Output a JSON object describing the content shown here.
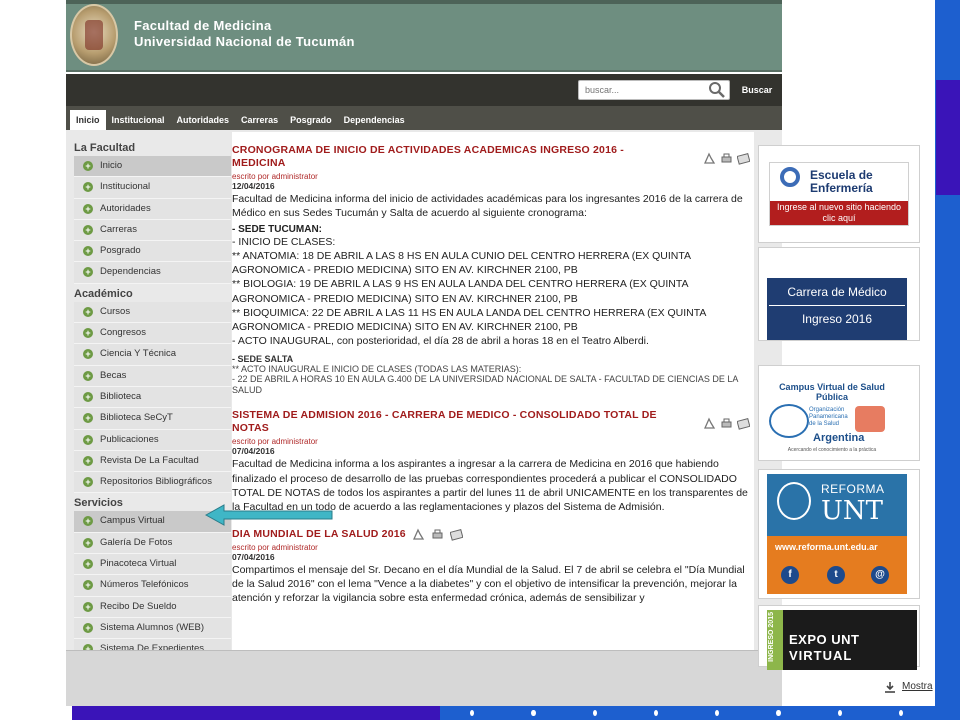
{
  "header": {
    "title_line1": "Facultad de Medicina",
    "title_line2": "Universidad Nacional de Tucumán"
  },
  "search": {
    "placeholder": "buscar...",
    "button_label": "Buscar"
  },
  "nav": {
    "tabs": [
      {
        "label": "Inicio"
      },
      {
        "label": "Institucional"
      },
      {
        "label": "Autoridades"
      },
      {
        "label": "Carreras"
      },
      {
        "label": "Posgrado"
      },
      {
        "label": "Dependencias"
      }
    ]
  },
  "sidebar": {
    "la_facultad": {
      "title": "La Facultad",
      "items": [
        {
          "label": "Inicio"
        },
        {
          "label": "Institucional"
        },
        {
          "label": "Autoridades"
        },
        {
          "label": "Carreras"
        },
        {
          "label": "Posgrado"
        },
        {
          "label": "Dependencias"
        }
      ]
    },
    "academico": {
      "title": "Académico",
      "items": [
        {
          "label": "Cursos"
        },
        {
          "label": "Congresos"
        },
        {
          "label": "Ciencia Y Técnica"
        },
        {
          "label": "Becas"
        },
        {
          "label": "Biblioteca"
        },
        {
          "label": "Biblioteca SeCyT"
        },
        {
          "label": "Publicaciones"
        },
        {
          "label": "Revista De La Facultad"
        },
        {
          "label": "Repositorios Bibliográficos"
        }
      ]
    },
    "servicios": {
      "title": "Servicios",
      "items": [
        {
          "label": "Campus Virtual"
        },
        {
          "label": "Galería De Fotos"
        },
        {
          "label": "Pinacoteca Virtual"
        },
        {
          "label": "Números Telefónicos"
        },
        {
          "label": "Recibo De Sueldo"
        },
        {
          "label": "Sistema Alumnos (WEB)"
        },
        {
          "label": "Sistema De Expedientes"
        }
      ]
    }
  },
  "articles": [
    {
      "title": "CRONOGRAMA DE INICIO DE ACTIVIDADES ACADEMICAS INGRESO 2016 - MEDICINA",
      "author": "escrito por administrator",
      "date": "12/04/2016",
      "intro": "Facultad de Medicina informa del inicio de actividades académicas para los ingresantes 2016 de la carrera de Médico en sus Sedes Tucumán y Salta de acuerdo al siguiente cronograma:",
      "sede_tucuman": "- SEDE TUCUMAN:",
      "inicio": "- INICIO DE CLASES:",
      "anatomia": "** ANATOMIA: 18 DE ABRIL A LAS 8 HS EN AULA CUNIO DEL CENTRO HERRERA (EX QUINTA AGRONOMICA - PREDIO MEDICINA) SITO EN AV. KIRCHNER 2100, PB",
      "biologia": "** BIOLOGIA: 19 DE ABRIL A LAS 9 HS EN AULA LANDA DEL CENTRO HERRERA (EX QUINTA AGRONOMICA - PREDIO MEDICINA) SITO EN AV. KIRCHNER 2100, PB",
      "bioquimica": "** BIOQUIMICA: 22 DE ABRIL A LAS 11 HS EN AULA LANDA DEL CENTRO HERRERA (EX QUINTA AGRONOMICA - PREDIO MEDICINA) SITO EN AV. KIRCHNER 2100, PB",
      "acto": "- ACTO INAUGURAL, con posterioridad, el día 28 de abril a horas 18 en el Teatro Alberdi.",
      "sede_salta": "- SEDE SALTA",
      "salta1": "** ACTO INAUGURAL E INICIO DE CLASES (TODAS LAS MATERIAS):",
      "salta2": "- 22 DE ABRIL A HORAS 10 EN AULA G.400 DE LA UNIVERSIDAD NACIONAL DE SALTA - FACULTAD DE CIENCIAS DE LA SALUD"
    },
    {
      "title": "SISTEMA DE ADMISION 2016 - CARRERA DE MEDICO - CONSOLIDADO TOTAL DE NOTAS",
      "author": "escrito por administrator",
      "date": "07/04/2016",
      "body": "Facultad de Medicina informa a los aspirantes a ingresar a la carrera de Medicina en 2016 que habiendo finalizado el proceso de desarrollo de las pruebas correspondientes procederá a publicar el CONSOLIDADO TOTAL DE NOTAS de todos los aspirantes a partir del lunes 11 de abril UNICAMENTE en los transparentes de la Facultad en un todo de acuerdo a las reglamentaciones y plazos del Sistema de Admisión."
    },
    {
      "title": "DIA MUNDIAL DE LA SALUD 2016",
      "author": "escrito por administrator",
      "date": "07/04/2016",
      "body": "Compartimos el mensaje del Sr. Decano en el día Mundial de la Salud. El 7 de abril se celebra el \"Día Mundial de la Salud 2016\" con el lema \"Vence a la diabetes\" y con el objetivo de intensificar la prevención, mejorar la atención y reforzar la vigilancia sobre esta enfermedad crónica, además de sensibilizar y"
    }
  ],
  "banners": {
    "escuela": {
      "title": "Escuela de Enfermería",
      "cta": "Ingrese al nuevo sitio haciendo clic aquí"
    },
    "carrera": {
      "line1": "Carrera de Médico",
      "line2": "Ingreso 2016"
    },
    "campus": {
      "title": "Campus Virtual de Salud Pública",
      "org": "Organización Panamericana de la Salud",
      "country": "Argentina",
      "tagline": "Acercando el conocimiento a la práctica"
    },
    "reforma": {
      "line1": "REFORMA",
      "line2": "UNT",
      "url": "www.reforma.unt.edu.ar"
    },
    "expo": {
      "vertical": "INGRESO 2015",
      "line1": "EXPO UNT",
      "line2": "VIRTUAL"
    }
  },
  "download_bar": {
    "label": "Mostra"
  },
  "colors": {
    "header_green": "#6e8e80",
    "title_red": "#a01c1c",
    "bullet_green": "#6d9a44",
    "slide_blue": "#1d5fcf",
    "slide_purple": "#3a14b8"
  }
}
